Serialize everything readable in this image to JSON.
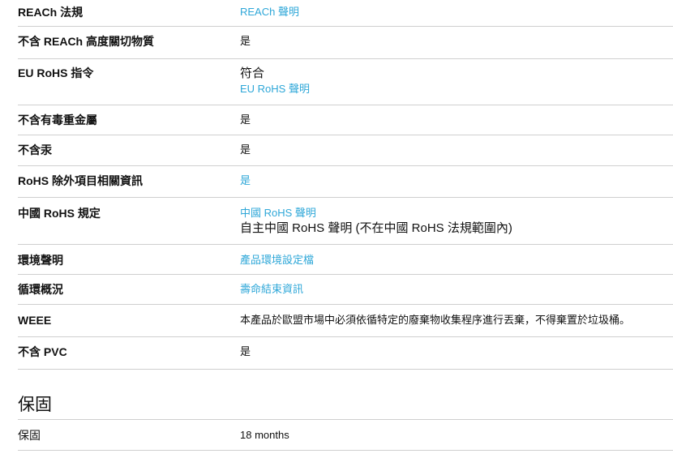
{
  "compliance": {
    "rows": [
      {
        "label": "REACh 法規",
        "lines": [
          {
            "text": "REACh 聲明",
            "link": true
          }
        ]
      },
      {
        "label": "不含 REACh 高度關切物質",
        "lines": [
          {
            "text": "是",
            "link": false
          }
        ]
      },
      {
        "label": "EU RoHS 指令",
        "lines": [
          {
            "text": "符合",
            "link": false
          },
          {
            "text": "EU RoHS 聲明",
            "link": true
          }
        ]
      },
      {
        "label": "不含有毒重金屬",
        "lines": [
          {
            "text": "是",
            "link": false
          }
        ]
      },
      {
        "label": "不含汞",
        "lines": [
          {
            "text": "是",
            "link": false
          }
        ]
      },
      {
        "label": "RoHS 除外項目相關資訊",
        "lines": [
          {
            "text": "是",
            "link": true
          }
        ]
      },
      {
        "label": "中國 RoHS 規定",
        "lines": [
          {
            "text": "中國 RoHS 聲明",
            "link": true
          },
          {
            "text": "自主中國 RoHS 聲明 (不在中國 RoHS 法規範圍內)",
            "link": false,
            "large": true
          }
        ]
      },
      {
        "label": "環境聲明",
        "lines": [
          {
            "text": "產品環境設定檔",
            "link": true
          }
        ]
      },
      {
        "label": "循環概況",
        "lines": [
          {
            "text": "壽命結束資訊",
            "link": true
          }
        ]
      },
      {
        "label": "WEEE",
        "lines": [
          {
            "text": "本產品於歐盟市場中必須依循特定的廢棄物收集程序進行丟棄，不得棄置於垃圾桶。",
            "link": false
          }
        ]
      },
      {
        "label": "不含 PVC",
        "lines": [
          {
            "text": "是",
            "link": false
          }
        ]
      }
    ],
    "colors": {
      "link": "#2ea7d8",
      "divider": "#cfcfcf",
      "text": "#111111"
    }
  },
  "warranty": {
    "title": "保固",
    "label": "保固",
    "value": "18 months"
  }
}
